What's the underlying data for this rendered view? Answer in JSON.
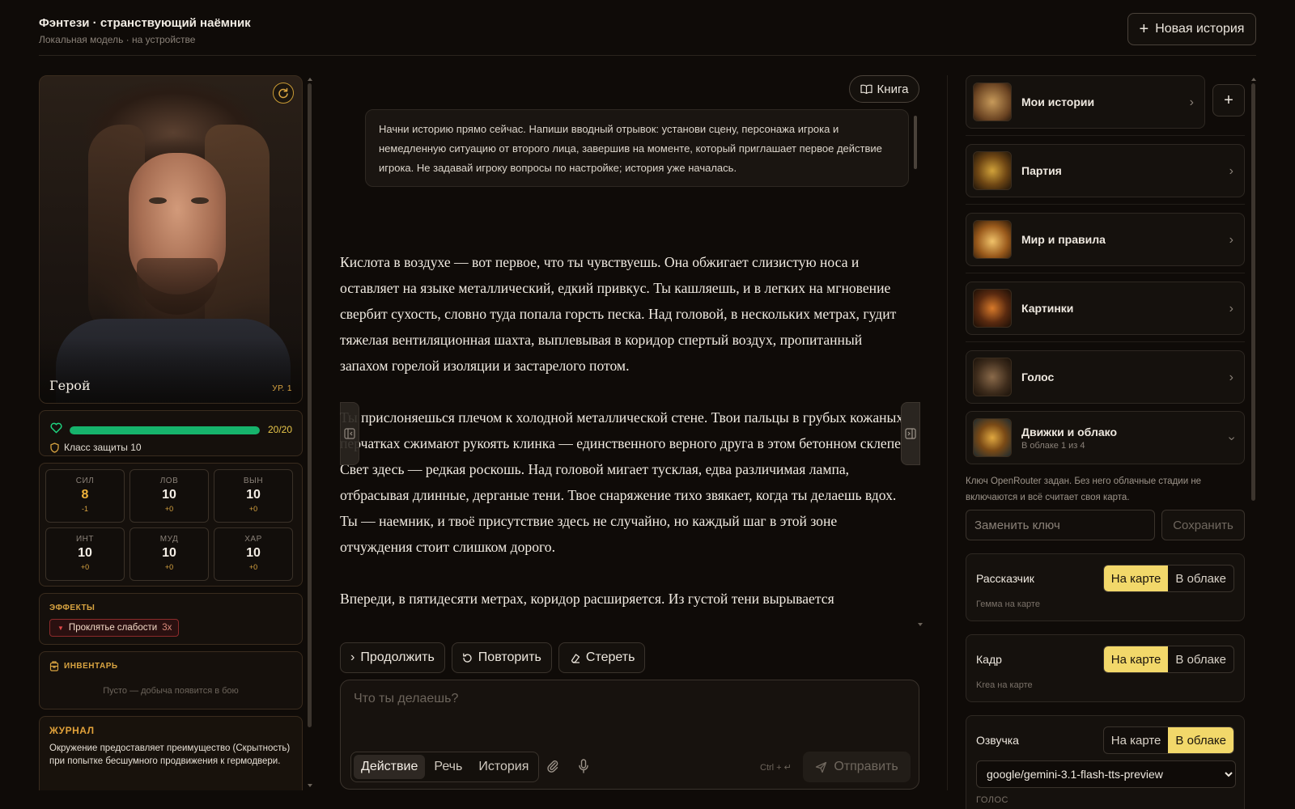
{
  "header": {
    "title": "Фэнтези · странствующий наёмник",
    "subtitle": "Локальная модель · на устройстве",
    "new_story_label": "Новая история"
  },
  "character": {
    "name": "Герой",
    "level": "УР. 1",
    "hp_text": "20/20",
    "hp_fraction": 1.0,
    "armor_class": "Класс защиты 10",
    "stats": [
      {
        "label": "СИЛ",
        "value": "8",
        "mod": "-1"
      },
      {
        "label": "ЛОВ",
        "value": "10",
        "mod": "+0"
      },
      {
        "label": "ВЫН",
        "value": "10",
        "mod": "+0"
      },
      {
        "label": "ИНТ",
        "value": "10",
        "mod": "+0"
      },
      {
        "label": "МУД",
        "value": "10",
        "mod": "+0"
      },
      {
        "label": "ХАР",
        "value": "10",
        "mod": "+0"
      }
    ],
    "effects_title": "ЭФФЕКТЫ",
    "effect": {
      "name": "Проклятье слабости",
      "count": "3x"
    },
    "inventory_title": "ИНВЕНТАРЬ",
    "inventory_empty": "Пусто — добыча появится в бою",
    "journal_title": "ЖУРНАЛ",
    "journal_text": "Окружение предоставляет преимущество (Скрытность) при попытке бесшумного продвижения к гермодвери."
  },
  "center": {
    "book_label": "Книга",
    "prompt": "Начни историю прямо сейчас. Напиши вводный отрывок: установи сцену, персонажа игрока и немедленную ситуацию от второго лица, завершив на моменте, который приглашает первое действие игрока. Не задавай игроку вопросы по настройке; история уже началась.",
    "story": [
      "Кислота в воздухе — вот первое, что ты чувствуешь. Она обжигает слизистую носа и оставляет на языке металлический, едкий привкус. Ты кашляешь, и в легких на мгновение свербит сухость, словно туда попала горсть песка. Над головой, в нескольких метрах, гудит тяжелая вентиляционная шахта, выплевывая в коридор спертый воздух, пропитанный запахом горелой изоляции и застарелого потом.",
      "Ты прислоняешься плечом к холодной металлической стене. Твои пальцы в грубых кожаных перчатках сжимают рукоять клинка — единственного верного друга в этом бетонном склепе. Свет здесь — редкая роскошь. Над головой мигает тусклая, едва различимая лампа, отбрасывая длинные, дерганые тени. Твое снаряжение тихо звякает, когда ты делаешь вдох. Ты — наемник, и твоё присутствие здесь не случайно, но каждый шаг в этой зоне отчуждения стоит слишком дорого.",
      "Впереди, в пятидесяти метрах, коридор расширяется. Из густой тени вырывается"
    ],
    "actions": {
      "continue": "Продолжить",
      "retry": "Повторить",
      "erase": "Стереть"
    },
    "input_placeholder": "Что ты делаешь?",
    "modes": [
      "Действие",
      "Речь",
      "История"
    ],
    "active_mode": "Действие",
    "shortcut_hint": "Ctrl + ↵",
    "send_label": "Отправить"
  },
  "right": {
    "nav": [
      {
        "label": "Мои истории",
        "icon": "scroll-icon"
      },
      {
        "label": "Партия",
        "icon": "emblem-icon"
      },
      {
        "label": "Мир и правила",
        "icon": "book-icon"
      },
      {
        "label": "Картинки",
        "icon": "frame-icon"
      },
      {
        "label": "Голос",
        "icon": "statue-icon"
      },
      {
        "label": "Движки и облако",
        "sub": "В облаке 1 из 4",
        "icon": "orb-icon"
      }
    ],
    "key_note": "Ключ OpenRouter задан. Без него облачные стадии не включаются и всё считает своя карта.",
    "key_placeholder": "Заменить ключ",
    "save_label": "Сохранить",
    "engines": [
      {
        "name": "Рассказчик",
        "note": "Гемма на карте",
        "on_card": "На карте",
        "in_cloud": "В облаке",
        "selected": "card"
      },
      {
        "name": "Кадр",
        "note": "Krea на карте",
        "on_card": "На карте",
        "in_cloud": "В облаке",
        "selected": "card"
      },
      {
        "name": "Озвучка",
        "on_card": "На карте",
        "in_cloud": "В облаке",
        "selected": "cloud",
        "model": "google/gemini-3.1-flash-tts-preview",
        "voice_label": "ГОЛОС"
      }
    ]
  },
  "colors": {
    "accent": "#d9a441",
    "hp": "#16b36c",
    "toggle_on": "#f2d86a",
    "debuff": "#8c2b2b"
  }
}
